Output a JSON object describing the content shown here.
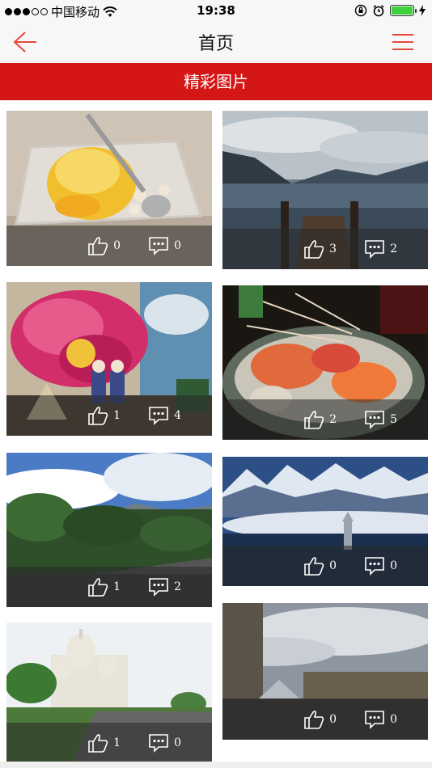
{
  "status_bar": {
    "carrier": "中国移动",
    "time": "19:38"
  },
  "nav": {
    "title": "首页",
    "back_icon": "arrow-left-icon",
    "menu_icon": "hamburger-menu-icon"
  },
  "banner": {
    "label": "精彩图片"
  },
  "colors": {
    "accent": "#d41616",
    "nav_icon": "#e8483a"
  },
  "photos": [
    {
      "subject": "mango shaved ice dessert",
      "likes": "0",
      "comments": "0"
    },
    {
      "subject": "lake pier with mountains",
      "likes": "3",
      "comments": "2"
    },
    {
      "subject": "pink flower mural",
      "likes": "1",
      "comments": "4"
    },
    {
      "subject": "seafood sashimi platter",
      "likes": "2",
      "comments": "5"
    },
    {
      "subject": "forest and sky",
      "likes": "1",
      "comments": "2"
    },
    {
      "subject": "snowy mountains and castle",
      "likes": "0",
      "comments": "0"
    },
    {
      "subject": "white basilica on hill",
      "likes": "1",
      "comments": "0"
    },
    {
      "subject": "louvre palace",
      "likes": "0",
      "comments": "0"
    }
  ]
}
